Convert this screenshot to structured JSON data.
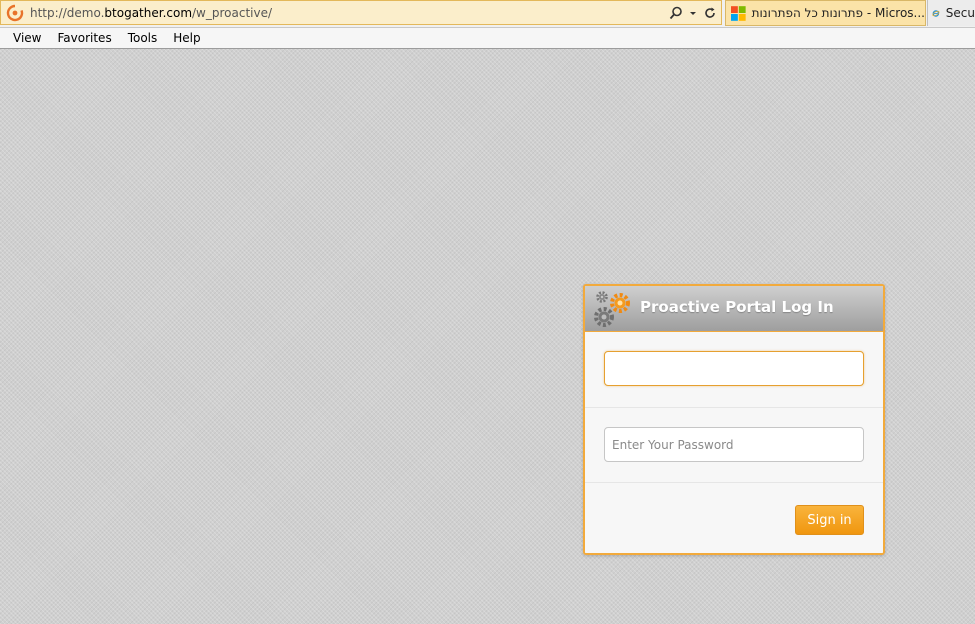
{
  "browser": {
    "address_bar": {
      "url_prefix": "http://demo.",
      "url_host": "btogather.com",
      "url_path": "/w_proactive/"
    },
    "tabs": [
      {
        "label": "פתרונות כל הפתרונות - Micros...",
        "icon": "windows-logo-icon",
        "active": true
      },
      {
        "label": "Secu",
        "icon": "ie-logo-icon",
        "active": false
      }
    ],
    "menu": [
      "View",
      "Favorites",
      "Tools",
      "Help"
    ]
  },
  "login": {
    "title": "Proactive Portal Log In",
    "username_value": "",
    "password_placeholder": "Enter Your Password",
    "signin_label": "Sign in"
  },
  "colors": {
    "accent": "#f2aa3c",
    "button": "#f4a020",
    "address_bar_bg": "#fbeecb"
  }
}
